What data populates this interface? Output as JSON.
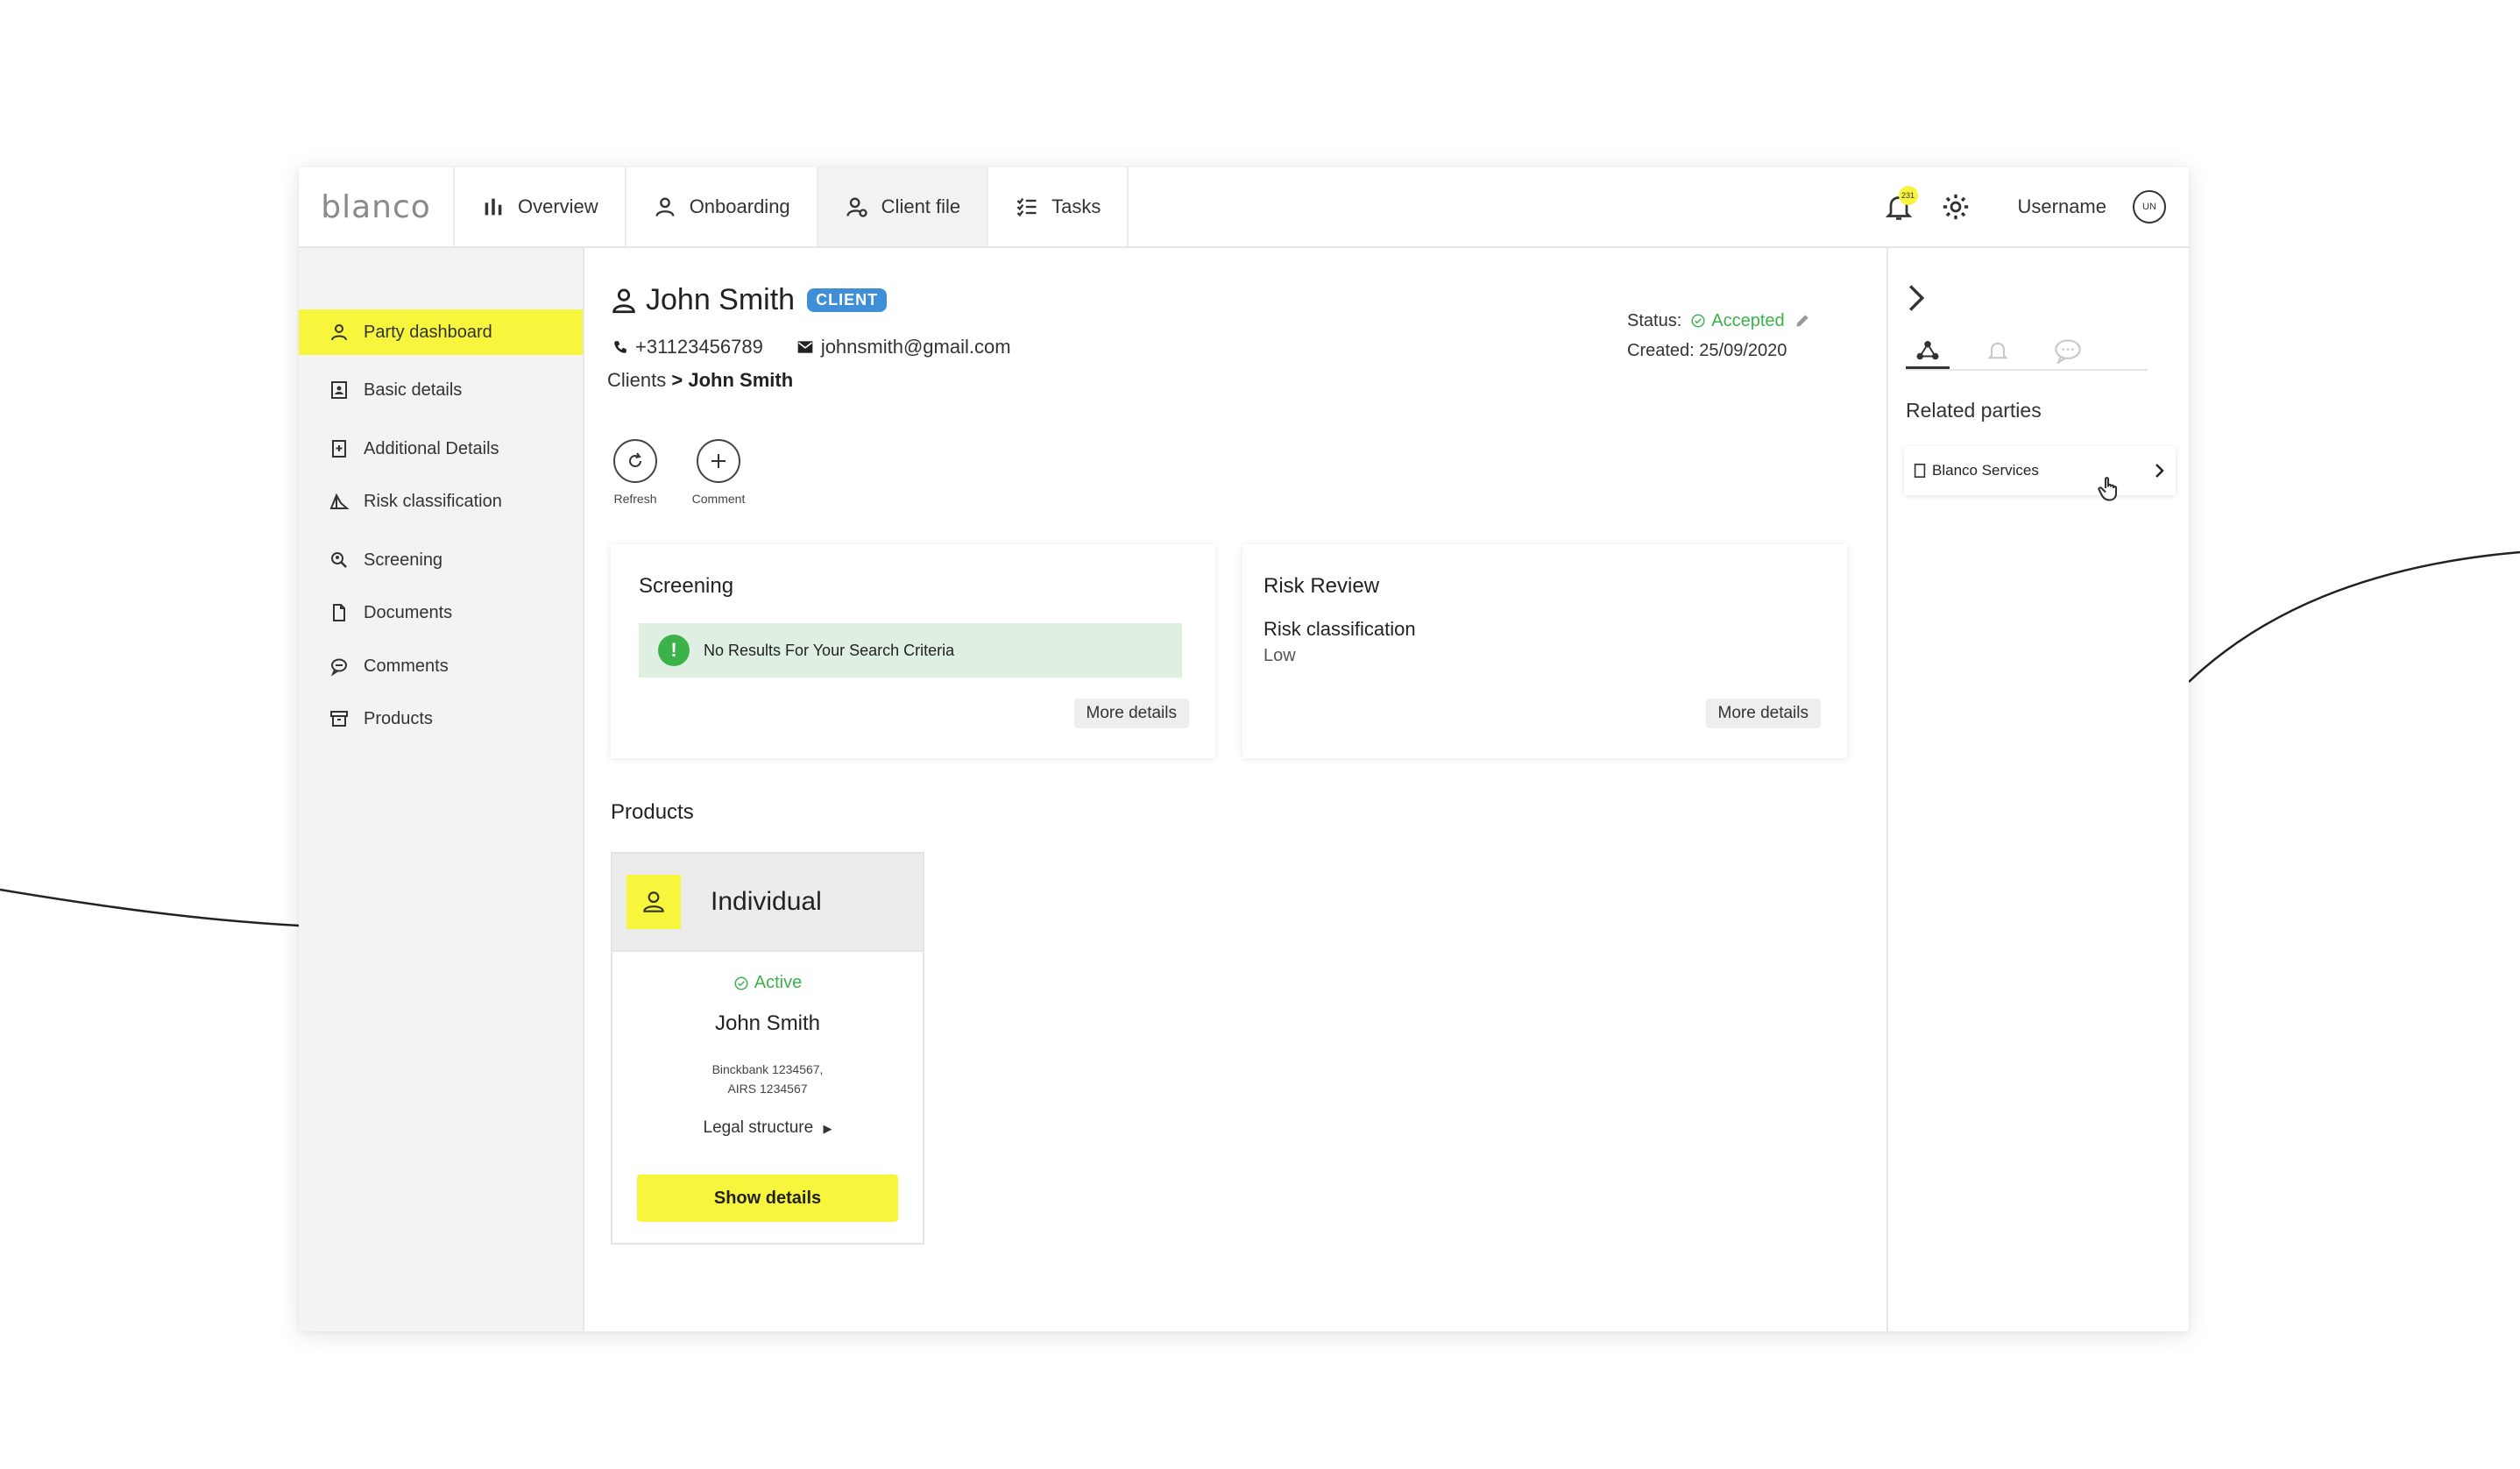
{
  "app": {
    "logo": "blanco"
  },
  "nav": {
    "tabs": [
      {
        "label": "Overview",
        "icon": "bar-chart-icon"
      },
      {
        "label": "Onboarding",
        "icon": "person-icon"
      },
      {
        "label": "Client file",
        "icon": "person-search-icon",
        "active": true
      },
      {
        "label": "Tasks",
        "icon": "checklist-icon"
      }
    ],
    "notifications_count": "231",
    "username": "Username",
    "avatar_initials": "UN"
  },
  "sidebar": {
    "items": [
      {
        "label": "Party dashboard",
        "icon": "person-icon",
        "active": true
      },
      {
        "label": "Basic details",
        "icon": "id-card-icon"
      },
      {
        "label": "Additional Details",
        "icon": "document-plus-icon"
      },
      {
        "label": "Risk classification",
        "icon": "risk-icon"
      },
      {
        "label": "Screening",
        "icon": "search-person-icon"
      },
      {
        "label": "Documents",
        "icon": "document-icon"
      },
      {
        "label": "Comments",
        "icon": "comment-icon"
      },
      {
        "label": "Products",
        "icon": "archive-icon"
      }
    ]
  },
  "client": {
    "name": "John Smith",
    "badge": "CLIENT",
    "phone": "+31123456789",
    "email": "johnsmith@gmail.com",
    "breadcrumb_root": "Clients",
    "breadcrumb_sep": ">",
    "breadcrumb_current": "John Smith",
    "status_label": "Status:",
    "status_value": "Accepted",
    "created": "Created: 25/09/2020"
  },
  "actions": [
    {
      "label": "Refresh",
      "icon": "refresh-icon"
    },
    {
      "label": "Comment",
      "icon": "plus-icon"
    }
  ],
  "screening": {
    "title": "Screening",
    "message": "No Results For Your Search Criteria",
    "more": "More details"
  },
  "risk_review": {
    "title": "Risk Review",
    "label": "Risk classification",
    "value": "Low",
    "more": "More details"
  },
  "products": {
    "title": "Products",
    "card": {
      "type": "Individual",
      "status": "Active",
      "name": "John Smith",
      "account_line1": "Binckbank 1234567,",
      "account_line2": "AIRS 1234567",
      "legal": "Legal structure",
      "button": "Show details"
    }
  },
  "right_panel": {
    "title": "Related parties",
    "items": [
      {
        "label": "Blanco Services"
      }
    ]
  },
  "colors": {
    "accent": "#f7f53c",
    "badge": "#3e8ed8",
    "success": "#3cb24a"
  }
}
